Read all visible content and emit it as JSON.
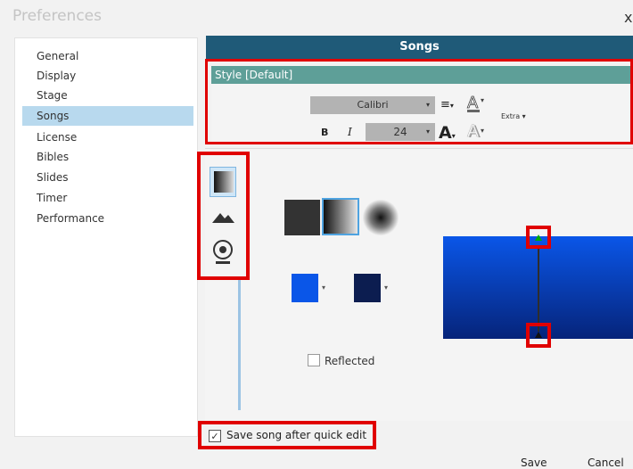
{
  "window": {
    "title": "Preferences",
    "close_glyph": "x"
  },
  "sidebar": {
    "items": [
      {
        "label": "General"
      },
      {
        "label": "Display"
      },
      {
        "label": "Stage"
      },
      {
        "label": "Songs"
      },
      {
        "label": "License"
      },
      {
        "label": "Bibles"
      },
      {
        "label": "Slides"
      },
      {
        "label": "Timer"
      },
      {
        "label": "Performance"
      }
    ],
    "selected": "Songs"
  },
  "panel": {
    "header": "Songs"
  },
  "style_bar": {
    "label": "Style [Default]"
  },
  "toolbar": {
    "font_family": "Calibri",
    "font_size": "24",
    "bold_label": "B",
    "italic_label": "I",
    "extra_label": "Extra",
    "grow_label": "A",
    "font_color_label": "A",
    "shadow_label": "A",
    "align_icon": "align-icon",
    "dropdown_glyph": "▾"
  },
  "gradient": {
    "color_a": "#0a56e8",
    "color_b": "#0c1d50",
    "reflected_label": "Reflected",
    "reflected_checked": false
  },
  "options": {
    "save_after_quick_edit_label": "Save song after quick edit",
    "save_after_quick_edit_checked": true,
    "check_glyph": "✓"
  },
  "footer": {
    "save_label": "Save",
    "cancel_label": "Cancel"
  },
  "colors": {
    "header_bg": "#1f5a78",
    "style_bar_bg": "#5e9f98",
    "selected_bg": "#b8d9ee",
    "highlight": "#e00000"
  }
}
